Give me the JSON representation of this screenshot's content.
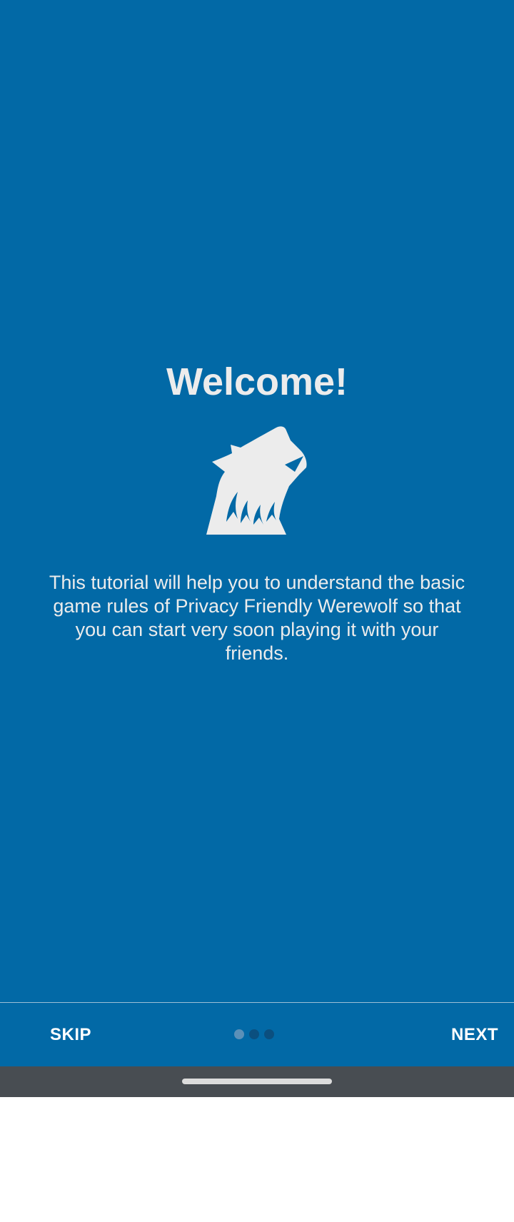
{
  "app": {
    "background_color": "#0269a6",
    "text_color": "#ececec"
  },
  "tutorial": {
    "title": "Welcome!",
    "logo_icon": "werewolf-howling-icon",
    "description": "This tutorial will help you to understand the basic game rules of Privacy Friendly Werewolf so that you can start very soon playing it with your friends."
  },
  "bottom_bar": {
    "skip_label": "SKIP",
    "next_label": "NEXT",
    "page_count": 3,
    "current_page": 1
  },
  "system_nav": {
    "handle_icon": "home-gesture-handle"
  }
}
